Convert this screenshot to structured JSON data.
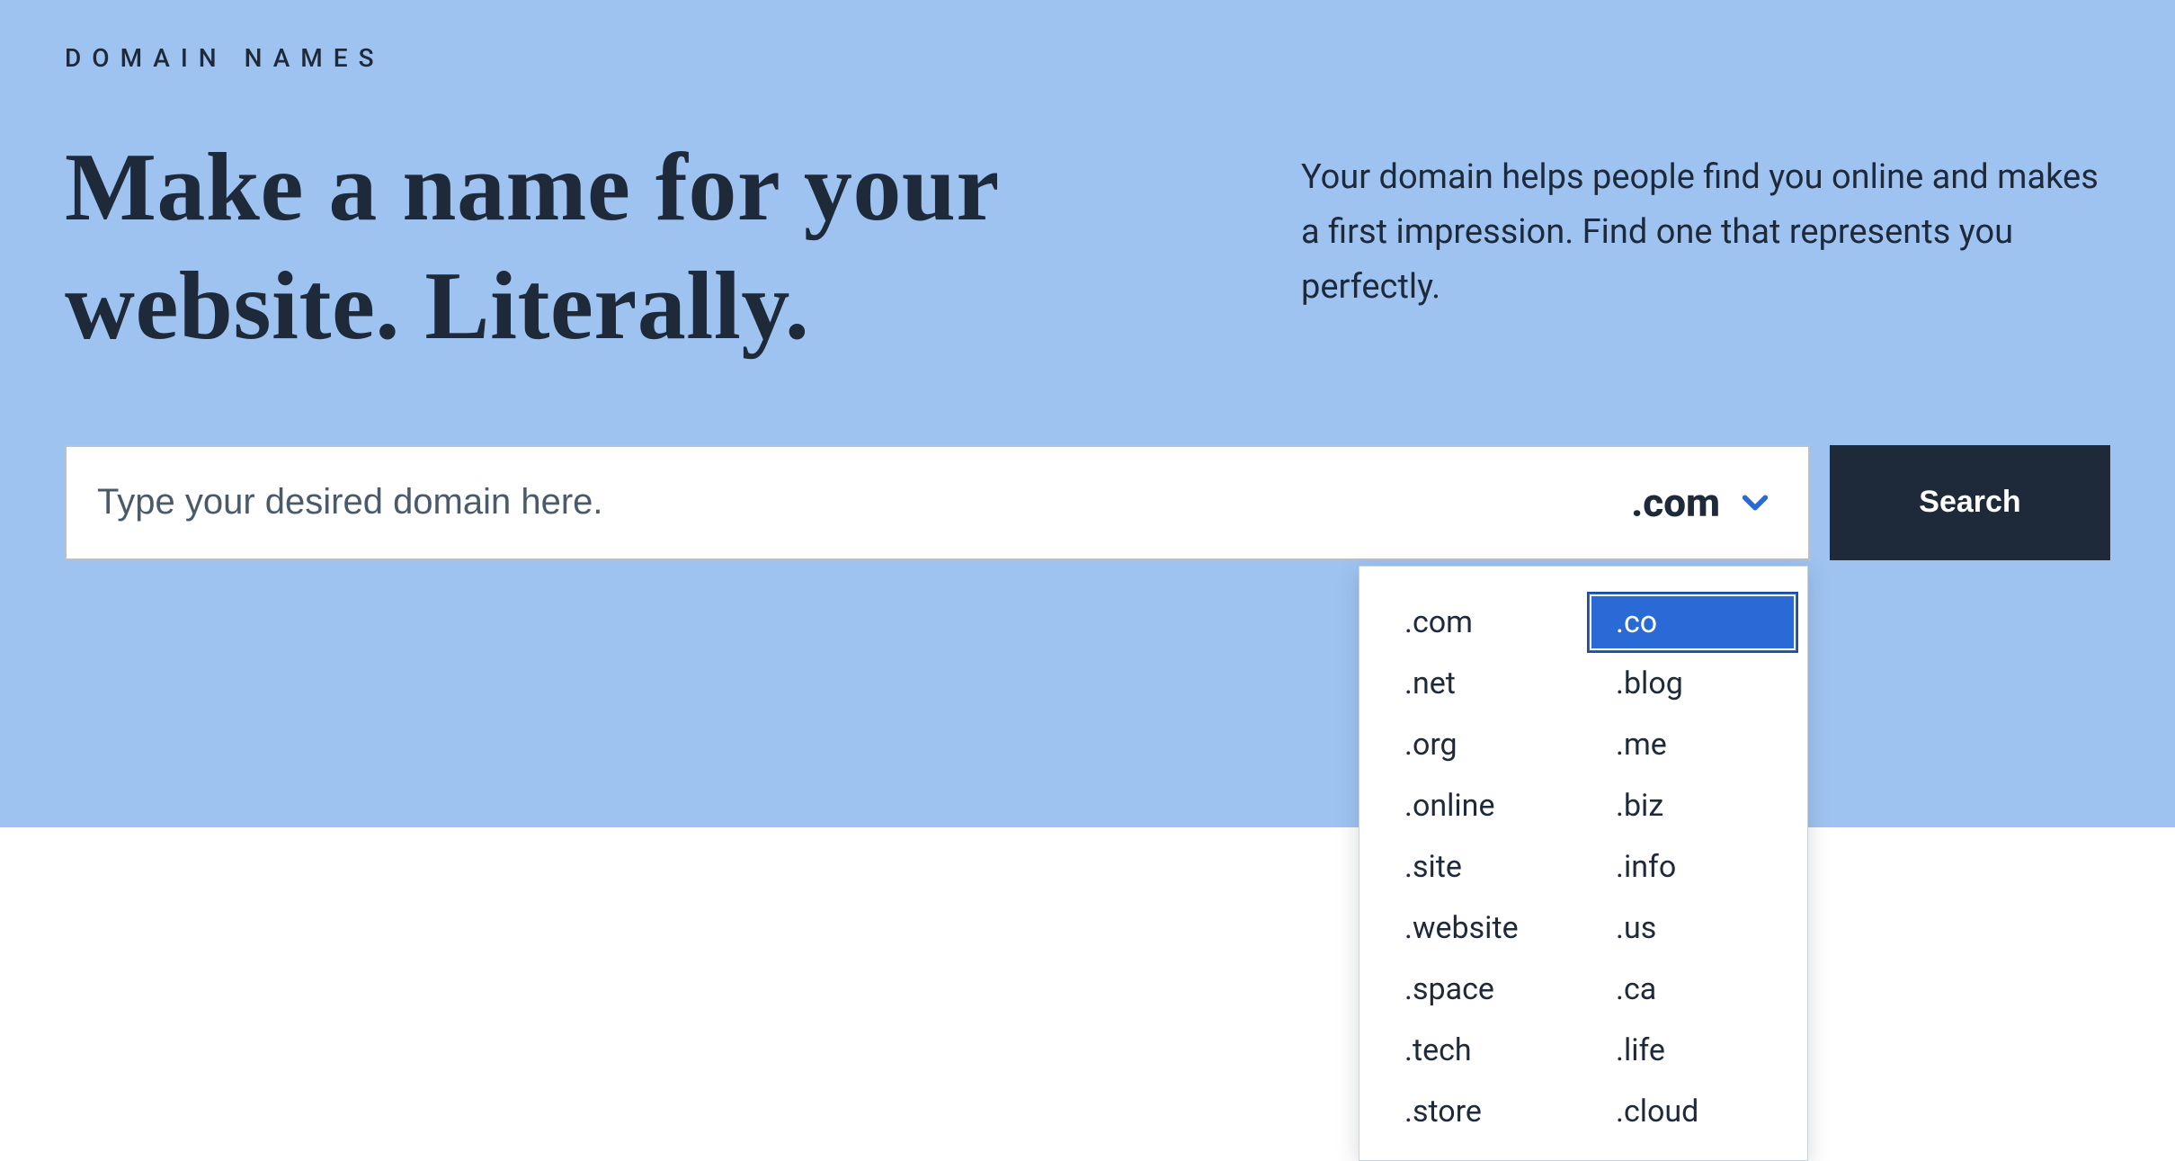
{
  "hero": {
    "eyebrow": "DOMAIN NAMES",
    "headline": "Make a name for your website. Literally.",
    "subhead": "Your domain helps people find you online and makes a first impression. Find one that represents you perfectly."
  },
  "search": {
    "placeholder": "Type your desired domain here.",
    "value": "",
    "selected_tld": ".com",
    "button_label": "Search"
  },
  "tld_dropdown": {
    "col1": [
      ".com",
      ".net",
      ".org",
      ".online",
      ".site",
      ".website",
      ".space",
      ".tech",
      ".store"
    ],
    "col2": [
      ".co",
      ".blog",
      ".me",
      ".biz",
      ".info",
      ".us",
      ".ca",
      ".life",
      ".cloud"
    ],
    "highlighted": ".co"
  },
  "colors": {
    "hero_bg": "#9fc3f1",
    "text_primary": "#1e2a3a",
    "accent_blue": "#2a6ad6",
    "button_bg": "#1e2a3a"
  }
}
